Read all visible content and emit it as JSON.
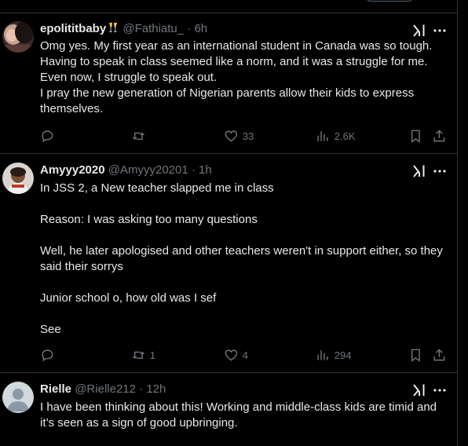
{
  "tweets": [
    {
      "name": "epolititbaby",
      "handle": "@Fathiatu_",
      "time": "6h",
      "text": "Omg yes. My first year as an international student in Canada was so tough. Having to speak in class seemed like a norm, and it was a struggle for me. Even now, I struggle to speak out.\nI pray the new generation of Nigerian parents allow their kids to express themselves.",
      "replies": "",
      "reposts": "",
      "likes": "33",
      "views": "2.6K"
    },
    {
      "name": "Amyyy2020",
      "handle": "@Amyyy20201",
      "time": "1h",
      "text": "In JSS 2, a New teacher slapped me in class\n\nReason: I was asking too many questions\n\nWell, he later apologised and other teachers weren't in support either, so they said their sorrys\n\nJunior school o, how old was I sef\n\nSee",
      "replies": "",
      "reposts": "1",
      "likes": "4",
      "views": "294"
    },
    {
      "name": "Rielle",
      "handle": "@Rielle212",
      "time": "12h",
      "text": "I have been thinking about this! Working and middle-class kids are timid and it’s seen as a sign of good upbringing.",
      "replies": "",
      "reposts": "",
      "likes": "",
      "views": ""
    }
  ],
  "separator": "·",
  "colors": {
    "background": "#000000",
    "text": "#e7e9ea",
    "muted": "#71767b",
    "border": "#2f3336"
  },
  "icons": [
    "grok-icon",
    "more-icon",
    "reply-icon",
    "repost-icon",
    "like-icon",
    "views-icon",
    "bookmark-icon",
    "share-icon",
    "champagne-emoji"
  ]
}
